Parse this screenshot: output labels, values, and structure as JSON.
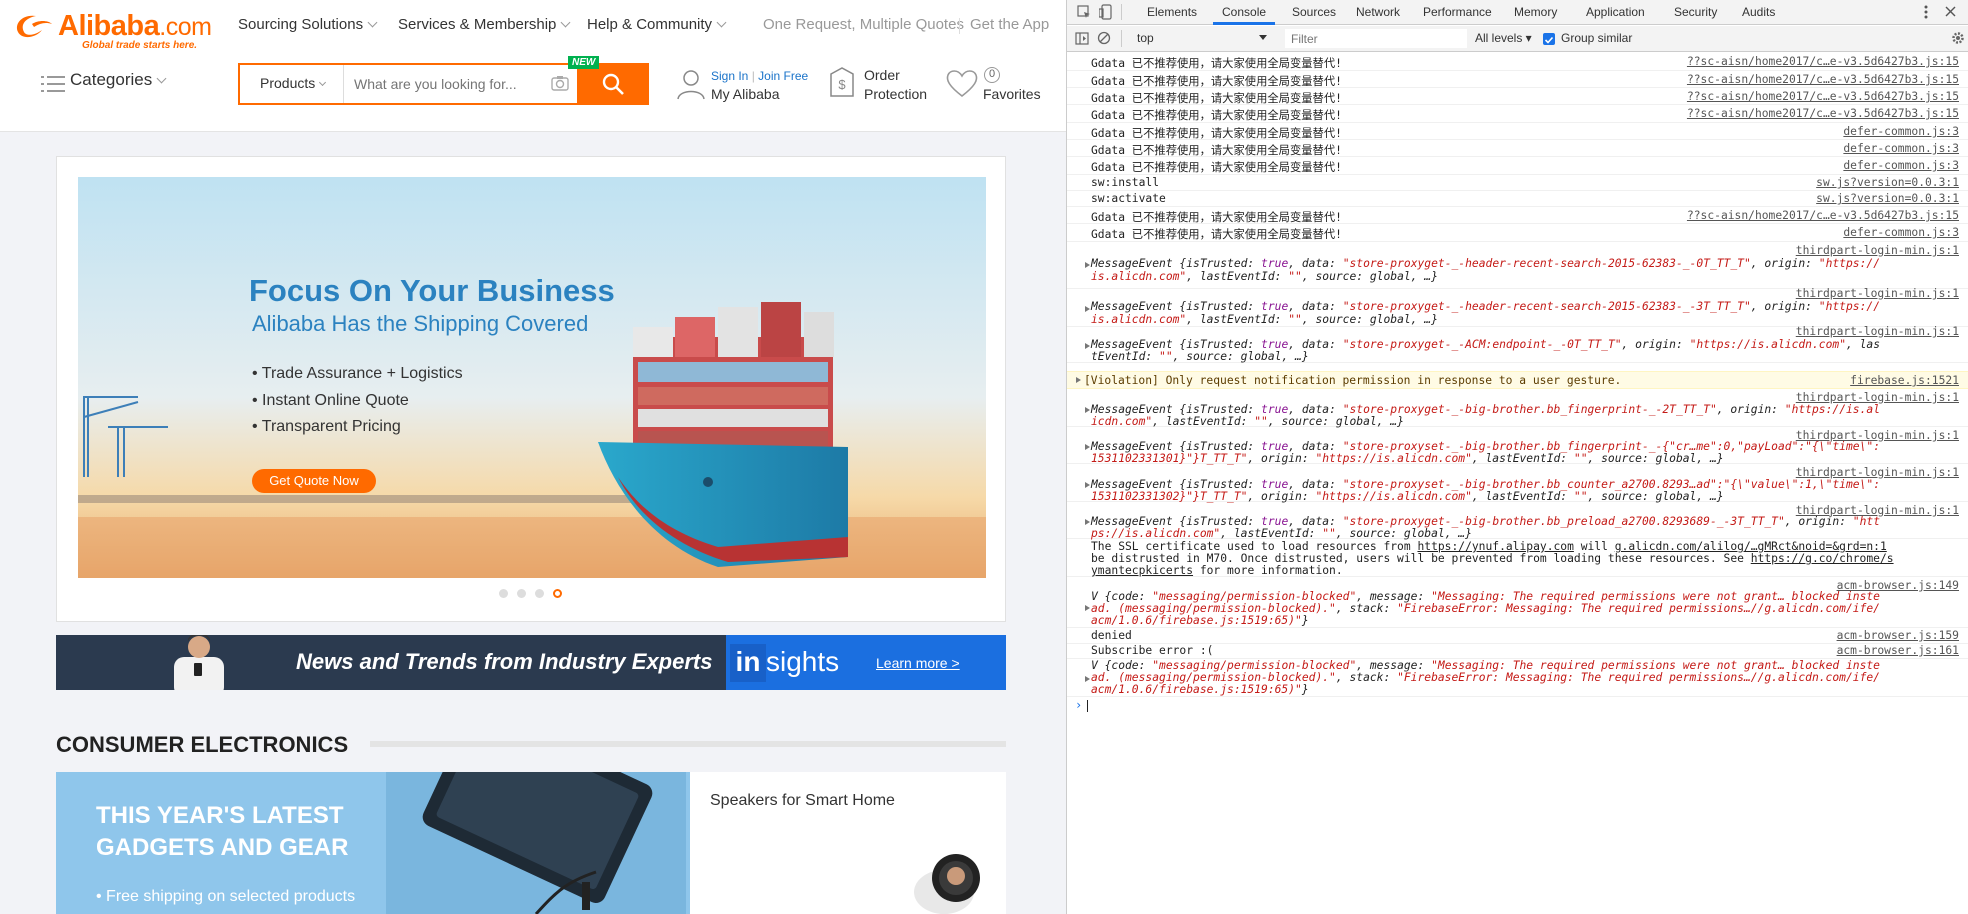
{
  "page": {
    "logo": {
      "name": "Alibaba",
      "tld": ".com",
      "tagline": "Global trade starts here."
    },
    "nav": [
      {
        "label": "Sourcing Solutions"
      },
      {
        "label": "Services & Membership"
      },
      {
        "label": "Help & Community"
      }
    ],
    "top_right": {
      "one_request": "One Request, Multiple Quotes",
      "get_app": "Get the App"
    },
    "categories_label": "Categories",
    "search": {
      "category": "Products",
      "placeholder": "What are you looking for...",
      "badge": "NEW"
    },
    "account": {
      "sign_in": "Sign In",
      "divider": "|",
      "join": "Join Free",
      "my_alibaba": "My Alibaba"
    },
    "order": {
      "line1": "Order",
      "line2": "Protection"
    },
    "favorites": {
      "count": "0",
      "label": "Favorites"
    },
    "banner": {
      "title": "Focus On Your Business",
      "subtitle": "Alibaba Has the Shipping Covered",
      "bullets": [
        "• Trade Assurance + Logistics",
        "• Instant Online Quote",
        "• Transparent Pricing"
      ],
      "cta": "Get Quote Now",
      "active_slide": 4,
      "slide_count": 4
    },
    "insights": {
      "headline": "News and Trends from Industry Experts",
      "brand_in": "in",
      "brand_sights": "sights",
      "learn_more": "Learn more >"
    },
    "section_title": "CONSUMER ELECTRONICS",
    "promo": {
      "line1": "THIS YEAR'S LATEST",
      "line2": "GADGETS AND GEAR",
      "line3": "• Free shipping on selected products"
    },
    "speaker_card": {
      "title": "Speakers for Smart Home"
    }
  },
  "devtools": {
    "tabs": [
      "Elements",
      "Console",
      "Sources",
      "Network",
      "Performance",
      "Memory",
      "Application",
      "Security",
      "Audits"
    ],
    "active_tab": "Console",
    "context": "top",
    "filter_placeholder": "Filter",
    "levels": "All levels ▾",
    "group_similar": "Group similar",
    "messages": {
      "m1": {
        "text": "Gdata 已不推荐使用，请大家使用全局变量替代!",
        "src": "??sc-aisn/home2017/c…e-v3.5d6427b3.js:15"
      },
      "m2": {
        "text": "Gdata 已不推荐使用，请大家使用全局变量替代!",
        "src": "??sc-aisn/home2017/c…e-v3.5d6427b3.js:15"
      },
      "m3": {
        "text": "Gdata 已不推荐使用，请大家使用全局变量替代!",
        "src": "??sc-aisn/home2017/c…e-v3.5d6427b3.js:15"
      },
      "m4": {
        "text": "Gdata 已不推荐使用，请大家使用全局变量替代!",
        "src": "??sc-aisn/home2017/c…e-v3.5d6427b3.js:15"
      },
      "m5": {
        "text": "Gdata 已不推荐使用，请大家使用全局变量替代!",
        "src": "defer-common.js:3"
      },
      "m6": {
        "text": "Gdata 已不推荐使用，请大家使用全局变量替代!",
        "src": "defer-common.js:3"
      },
      "m7": {
        "text": "Gdata 已不推荐使用，请大家使用全局变量替代!",
        "src": "defer-common.js:3"
      },
      "m8": {
        "text": "sw:install",
        "src": "sw.js?version=0.0.3:1"
      },
      "m9": {
        "text": "sw:activate",
        "src": "sw.js?version=0.0.3:1"
      },
      "m10": {
        "text": "Gdata 已不推荐使用，请大家使用全局变量替代!",
        "src": "??sc-aisn/home2017/c…e-v3.5d6427b3.js:15"
      },
      "m11": {
        "text": "Gdata 已不推荐使用，请大家使用全局变量替代!",
        "src": "defer-common.js:3"
      },
      "e1": {
        "src": "thirdpart-login-min.js:1",
        "l1a": "MessageEvent {isTrusted: ",
        "l1b": "true",
        "l1c": ", data: ",
        "l1d": "\"store-proxyget-_-header-recent-search-2015-62383-_-0T_TT_T\"",
        "l1e": ", origin: ",
        "l1f": "\"https://",
        "l2a": "is.alicdn.com\"",
        "l2b": ", lastEventId: ",
        "l2c": "\"\"",
        "l2d": ", source: global, …}"
      },
      "e2": {
        "src": "thirdpart-login-min.js:1",
        "l1a": "MessageEvent {isTrusted: ",
        "l1b": "true",
        "l1c": ", data: ",
        "l1d": "\"store-proxyget-_-header-recent-search-2015-62383-_-3T_TT_T\"",
        "l1e": ", origin: ",
        "l1f": "\"https://",
        "l2a": "is.alicdn.com\"",
        "l2b": ", lastEventId: ",
        "l2c": "\"\"",
        "l2d": ", source: global, …}"
      },
      "e3": {
        "src": "thirdpart-login-min.js:1",
        "l1a": "MessageEvent {isTrusted: ",
        "l1b": "true",
        "l1c": ", data: ",
        "l1d": "\"store-proxyget-_-ACM:endpoint-_-0T_TT_T\"",
        "l1e": ", origin: ",
        "l1f": "\"https://is.alicdn.com\"",
        "l1g": ", las",
        "l2a": "tEventId: ",
        "l2b": "\"\"",
        "l2c": ", source: global, …}"
      },
      "violation": {
        "text": "[Violation] Only request notification permission in response to a user gesture.",
        "src": "firebase.js:1521"
      },
      "e4": {
        "src": "thirdpart-login-min.js:1",
        "l1a": "MessageEvent {isTrusted: ",
        "l1b": "true",
        "l1c": ", data: ",
        "l1d": "\"store-proxyget-_-big-brother.bb_fingerprint-_-2T_TT_T\"",
        "l1e": ", origin: ",
        "l1f": "\"https://is.al",
        "l2a": "icdn.com\"",
        "l2b": ", lastEventId: ",
        "l2c": "\"\"",
        "l2d": ", source: global, …}"
      },
      "e5": {
        "src": "thirdpart-login-min.js:1",
        "l1a": "MessageEvent {isTrusted: ",
        "l1b": "true",
        "l1c": ", data: ",
        "l1d": "\"store-proxyset-_-big-brother.bb_fingerprint-_-{\"cr…me\":0,\"payLoad\":\"{\\\"time\\\":",
        "l2a": "1531102331301}\"}T_TT_T\"",
        "l2b": ", origin: ",
        "l2c": "\"https://is.alicdn.com\"",
        "l2d": ", lastEventId: ",
        "l2e": "\"\"",
        "l2f": ", source: global, …}"
      },
      "e6": {
        "src": "thirdpart-login-min.js:1",
        "l1a": "MessageEvent {isTrusted: ",
        "l1b": "true",
        "l1c": ", data: ",
        "l1d": "\"store-proxyset-_-big-brother.bb_counter_a2700.8293…ad\":\"{\\\"value\\\":1,\\\"time\\\":",
        "l2a": "1531102331302}\"}T_TT_T\"",
        "l2b": ", origin: ",
        "l2c": "\"https://is.alicdn.com\"",
        "l2d": ", lastEventId: ",
        "l2e": "\"\"",
        "l2f": ", source: global, …}"
      },
      "e7": {
        "src": "thirdpart-login-min.js:1",
        "l1a": "MessageEvent {isTrusted: ",
        "l1b": "true",
        "l1c": ", data: ",
        "l1d": "\"store-proxyget-_-big-brother.bb_preload_a2700.8293689-_-3T_TT_T\"",
        "l1e": ", origin: ",
        "l1f": "\"htt",
        "l2a": "ps://is.alicdn.com\"",
        "l2b": ", lastEventId: ",
        "l2c": "\"\"",
        "l2d": ", source: global, …}"
      },
      "ssl": {
        "l1a": "The SSL certificate used to load resources from ",
        "l1b": "https://ynuf.alipay.com",
        "l1c": " will ",
        "l1d": "g.alicdn.com/alilog/…gMRct&noid=&grd=n:1",
        "l2a": "be distrusted in M70. Once distrusted, users will be prevented from loading these resources. See ",
        "l2b": "https://g.co/chrome/s",
        "l3a": "ymantecpkicerts",
        "l3b": " for more information."
      },
      "v1": {
        "src": "acm-browser.js:149",
        "l1a": "V {code: ",
        "l1b": "\"messaging/permission-blocked\"",
        "l1c": ", message: ",
        "l1d": "\"Messaging: The required permissions were not grant… blocked inste",
        "l2a": "ad. (messaging/permission-blocked).\"",
        "l2b": ", stack: ",
        "l2c": "\"FirebaseError: Messaging: The required permissions…//g.alicdn.com/ife/",
        "l3a": "acm/1.0.6/firebase.js:1519:65)\"",
        "l3b": "}"
      },
      "denied": {
        "text": "denied",
        "src": "acm-browser.js:159"
      },
      "sub": {
        "text": "Subscribe error :(",
        "src": "acm-browser.js:161"
      },
      "v2": {
        "l1a": "V {code: ",
        "l1b": "\"messaging/permission-blocked\"",
        "l1c": ", message: ",
        "l1d": "\"Messaging: The required permissions were not grant… blocked inste",
        "l2a": "ad. (messaging/permission-blocked).\"",
        "l2b": ", stack: ",
        "l2c": "\"FirebaseError: Messaging: The required permissions…//g.alicdn.com/ife/",
        "l3a": "acm/1.0.6/firebase.js:1519:65)\"",
        "l3b": "}"
      },
      "prompt": "›"
    }
  }
}
